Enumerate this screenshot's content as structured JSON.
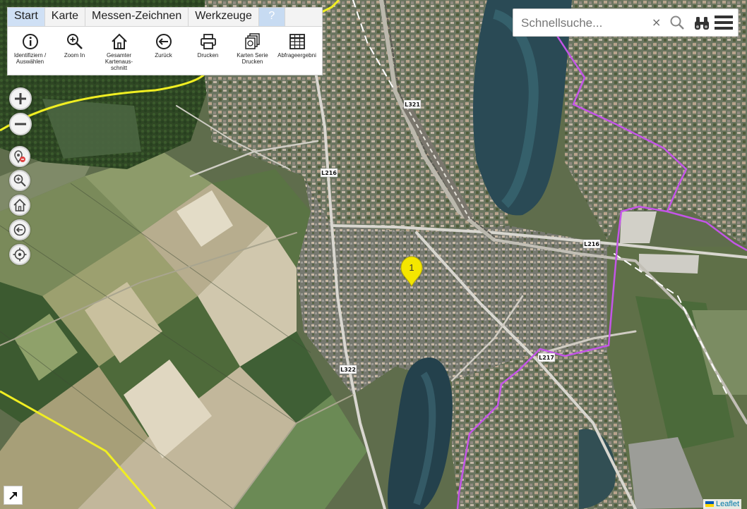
{
  "ribbon": {
    "tabs": [
      {
        "label": "Start",
        "active": true
      },
      {
        "label": "Karte"
      },
      {
        "label": "Messen-Zeichnen"
      },
      {
        "label": "Werkzeuge"
      },
      {
        "label": "?"
      }
    ],
    "tools": [
      {
        "label": "Identifiziern / Auswählen",
        "icon": "info-icon"
      },
      {
        "label": "Zoom In",
        "icon": "zoom-in-icon"
      },
      {
        "label": "Gesamter Kartenaus-schnitt",
        "icon": "home-icon"
      },
      {
        "label": "Zurück",
        "icon": "back-arrow-icon"
      },
      {
        "label": "Drucken",
        "icon": "printer-icon"
      },
      {
        "label": "Karten Serie Drucken",
        "icon": "print-series-icon"
      },
      {
        "label": "Abfrageergebni",
        "icon": "table-icon"
      }
    ]
  },
  "search": {
    "placeholder": "Schnellsuche...",
    "clear": "×"
  },
  "zoom": {
    "in": "+",
    "out": "−"
  },
  "map": {
    "marker_label": "1",
    "road_labels": [
      "L321",
      "L216",
      "L216",
      "L322",
      "L217"
    ],
    "colors": {
      "boundary": "#c455e8",
      "district": "#f0ee22",
      "marker": "#f4e600"
    }
  },
  "attribution": "Leaflet"
}
